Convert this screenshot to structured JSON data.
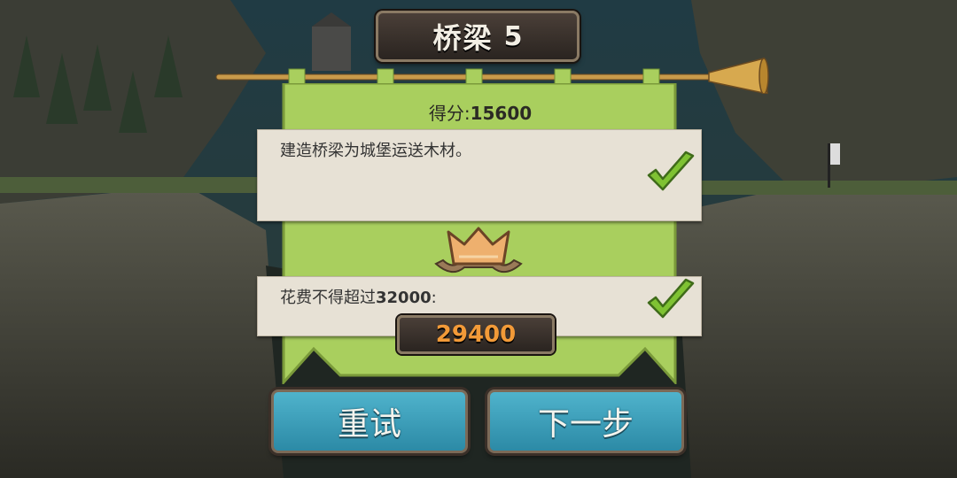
{
  "title": {
    "text": "桥梁",
    "level": "5"
  },
  "score": {
    "label": "得分:",
    "value": "15600"
  },
  "objectives": [
    {
      "text": "建造桥梁为城堡运送木材。",
      "completed": true
    },
    {
      "label": "花费不得超过",
      "limit": "32000",
      "suffix": ":",
      "completed": true
    }
  ],
  "cost": {
    "value": "29400"
  },
  "buttons": {
    "retry": "重试",
    "next": "下一步"
  },
  "icons": {
    "check": "checkmark-icon",
    "crown": "crown-icon",
    "trumpet": "trumpet-icon"
  },
  "colors": {
    "banner": "#a9cf5e",
    "paper": "#e7e1d5",
    "button": "#3aa0bb",
    "cost_text": "#f29a38",
    "check": "#7fc233"
  }
}
